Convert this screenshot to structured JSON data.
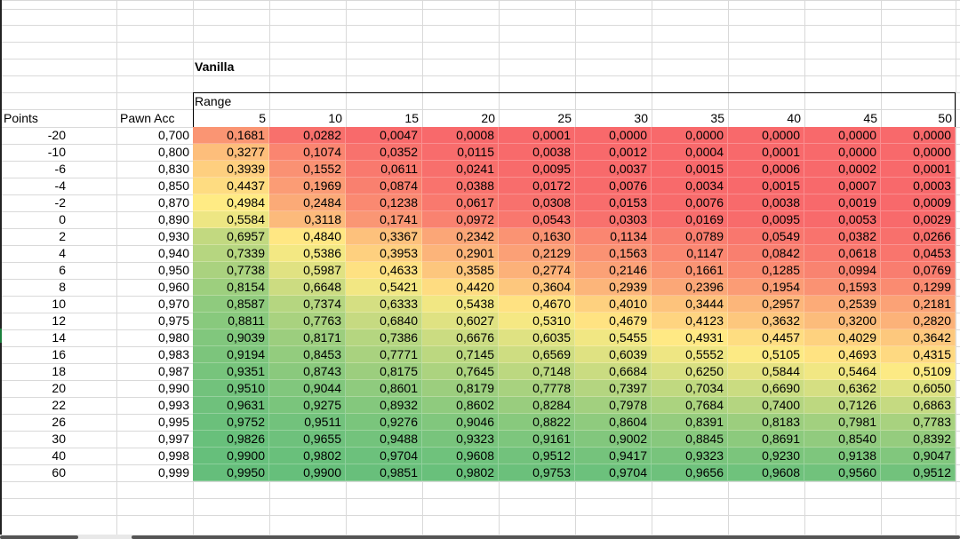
{
  "sheet": {
    "title": "Vanilla",
    "range_label": "Range",
    "points_header": "Points",
    "pawn_acc_header": "Pawn Acc",
    "ranges": [
      "5",
      "10",
      "15",
      "20",
      "25",
      "30",
      "35",
      "40",
      "45",
      "50"
    ],
    "rows": [
      {
        "points": "-20",
        "acc": "0,700",
        "values": [
          "0,1681",
          "0,0282",
          "0,0047",
          "0,0008",
          "0,0001",
          "0,0000",
          "0,0000",
          "0,0000",
          "0,0000",
          "0,0000"
        ]
      },
      {
        "points": "-10",
        "acc": "0,800",
        "values": [
          "0,3277",
          "0,1074",
          "0,0352",
          "0,0115",
          "0,0038",
          "0,0012",
          "0,0004",
          "0,0001",
          "0,0000",
          "0,0000"
        ]
      },
      {
        "points": "-6",
        "acc": "0,830",
        "values": [
          "0,3939",
          "0,1552",
          "0,0611",
          "0,0241",
          "0,0095",
          "0,0037",
          "0,0015",
          "0,0006",
          "0,0002",
          "0,0001"
        ]
      },
      {
        "points": "-4",
        "acc": "0,850",
        "values": [
          "0,4437",
          "0,1969",
          "0,0874",
          "0,0388",
          "0,0172",
          "0,0076",
          "0,0034",
          "0,0015",
          "0,0007",
          "0,0003"
        ]
      },
      {
        "points": "-2",
        "acc": "0,870",
        "values": [
          "0,4984",
          "0,2484",
          "0,1238",
          "0,0617",
          "0,0308",
          "0,0153",
          "0,0076",
          "0,0038",
          "0,0019",
          "0,0009"
        ]
      },
      {
        "points": "0",
        "acc": "0,890",
        "values": [
          "0,5584",
          "0,3118",
          "0,1741",
          "0,0972",
          "0,0543",
          "0,0303",
          "0,0169",
          "0,0095",
          "0,0053",
          "0,0029"
        ]
      },
      {
        "points": "2",
        "acc": "0,930",
        "values": [
          "0,6957",
          "0,4840",
          "0,3367",
          "0,2342",
          "0,1630",
          "0,1134",
          "0,0789",
          "0,0549",
          "0,0382",
          "0,0266"
        ]
      },
      {
        "points": "4",
        "acc": "0,940",
        "values": [
          "0,7339",
          "0,5386",
          "0,3953",
          "0,2901",
          "0,2129",
          "0,1563",
          "0,1147",
          "0,0842",
          "0,0618",
          "0,0453"
        ]
      },
      {
        "points": "6",
        "acc": "0,950",
        "values": [
          "0,7738",
          "0,5987",
          "0,4633",
          "0,3585",
          "0,2774",
          "0,2146",
          "0,1661",
          "0,1285",
          "0,0994",
          "0,0769"
        ]
      },
      {
        "points": "8",
        "acc": "0,960",
        "values": [
          "0,8154",
          "0,6648",
          "0,5421",
          "0,4420",
          "0,3604",
          "0,2939",
          "0,2396",
          "0,1954",
          "0,1593",
          "0,1299"
        ]
      },
      {
        "points": "10",
        "acc": "0,970",
        "values": [
          "0,8587",
          "0,7374",
          "0,6333",
          "0,5438",
          "0,4670",
          "0,4010",
          "0,3444",
          "0,2957",
          "0,2539",
          "0,2181"
        ]
      },
      {
        "points": "12",
        "acc": "0,975",
        "values": [
          "0,8811",
          "0,7763",
          "0,6840",
          "0,6027",
          "0,5310",
          "0,4679",
          "0,4123",
          "0,3632",
          "0,3200",
          "0,2820"
        ]
      },
      {
        "points": "14",
        "acc": "0,980",
        "values": [
          "0,9039",
          "0,8171",
          "0,7386",
          "0,6676",
          "0,6035",
          "0,5455",
          "0,4931",
          "0,4457",
          "0,4029",
          "0,3642"
        ]
      },
      {
        "points": "16",
        "acc": "0,983",
        "values": [
          "0,9194",
          "0,8453",
          "0,7771",
          "0,7145",
          "0,6569",
          "0,6039",
          "0,5552",
          "0,5105",
          "0,4693",
          "0,4315"
        ]
      },
      {
        "points": "18",
        "acc": "0,987",
        "values": [
          "0,9351",
          "0,8743",
          "0,8175",
          "0,7645",
          "0,7148",
          "0,6684",
          "0,6250",
          "0,5844",
          "0,5464",
          "0,5109"
        ]
      },
      {
        "points": "20",
        "acc": "0,990",
        "values": [
          "0,9510",
          "0,9044",
          "0,8601",
          "0,8179",
          "0,7778",
          "0,7397",
          "0,7034",
          "0,6690",
          "0,6362",
          "0,6050"
        ]
      },
      {
        "points": "22",
        "acc": "0,993",
        "values": [
          "0,9631",
          "0,9275",
          "0,8932",
          "0,8602",
          "0,8284",
          "0,7978",
          "0,7684",
          "0,7400",
          "0,7126",
          "0,6863"
        ]
      },
      {
        "points": "26",
        "acc": "0,995",
        "values": [
          "0,9752",
          "0,9511",
          "0,9276",
          "0,9046",
          "0,8822",
          "0,8604",
          "0,8391",
          "0,8183",
          "0,7981",
          "0,7783"
        ]
      },
      {
        "points": "30",
        "acc": "0,997",
        "values": [
          "0,9826",
          "0,9655",
          "0,9488",
          "0,9323",
          "0,9161",
          "0,9002",
          "0,8845",
          "0,8691",
          "0,8540",
          "0,8392"
        ]
      },
      {
        "points": "40",
        "acc": "0,998",
        "values": [
          "0,9900",
          "0,9802",
          "0,9704",
          "0,9608",
          "0,9512",
          "0,9417",
          "0,9323",
          "0,9230",
          "0,9138",
          "0,9047"
        ]
      },
      {
        "points": "60",
        "acc": "0,999",
        "values": [
          "0,9950",
          "0,9900",
          "0,9851",
          "0,9802",
          "0,9753",
          "0,9704",
          "0,9656",
          "0,9608",
          "0,9560",
          "0,9512"
        ]
      }
    ]
  },
  "colors": {
    "low": "#f8696b",
    "mid": "#ffeb84",
    "high": "#63be7b",
    "gridline": "#d9d9d9"
  }
}
